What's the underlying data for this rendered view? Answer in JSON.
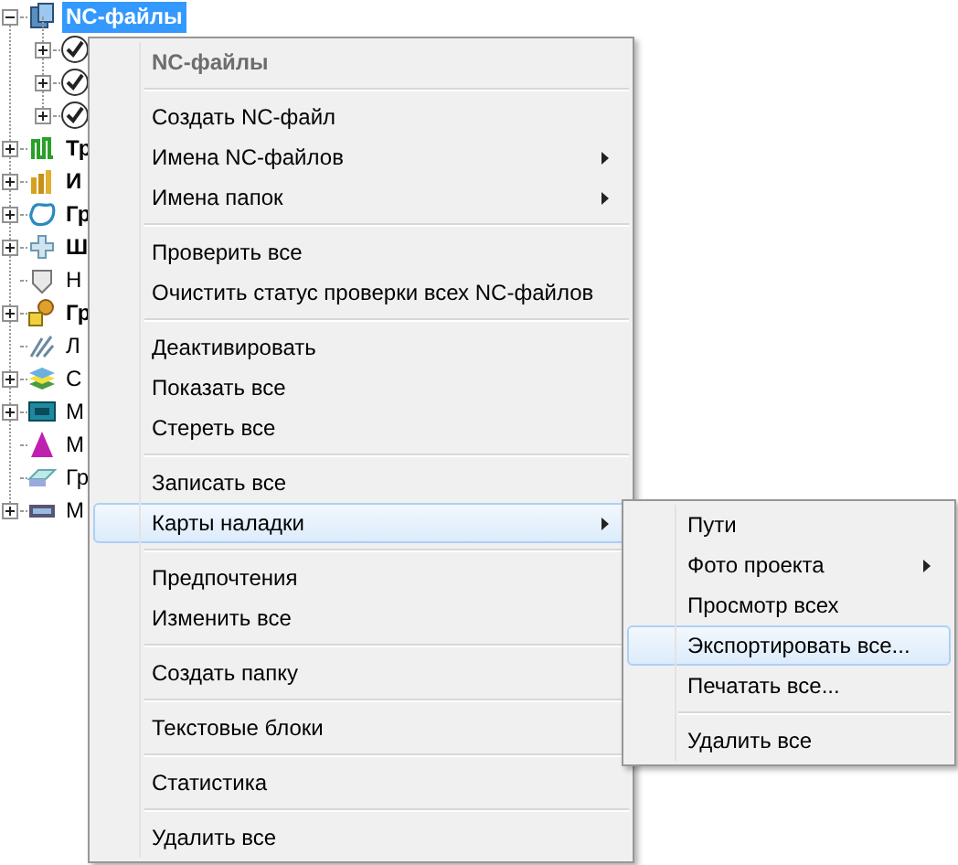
{
  "tree": [
    {
      "label": "NC-файлы",
      "bold": true,
      "selected": true,
      "expandable": true,
      "children": [
        {
          "expandable": true
        },
        {
          "expandable": true
        },
        {
          "expandable": true
        }
      ]
    },
    {
      "label": "Тр",
      "bold": true,
      "selected": false,
      "expandable": true
    },
    {
      "label": "И",
      "bold": true,
      "selected": false,
      "expandable": true
    },
    {
      "label": "Гр",
      "bold": true,
      "selected": false,
      "expandable": true
    },
    {
      "label": "Ш",
      "bold": true,
      "selected": false,
      "expandable": true
    },
    {
      "label": "Н",
      "bold": false,
      "selected": false,
      "expandable": false
    },
    {
      "label": "Гр",
      "bold": true,
      "selected": false,
      "expandable": true
    },
    {
      "label": "Л",
      "bold": false,
      "selected": false,
      "expandable": false
    },
    {
      "label": "С",
      "bold": false,
      "selected": false,
      "expandable": true
    },
    {
      "label": "М",
      "bold": false,
      "selected": false,
      "expandable": true
    },
    {
      "label": "М",
      "bold": false,
      "selected": false,
      "expandable": false
    },
    {
      "label": "Гр",
      "bold": false,
      "selected": false,
      "expandable": false
    },
    {
      "label": "М",
      "bold": false,
      "selected": false,
      "expandable": true
    }
  ],
  "context_menu": [
    {
      "kind": "header",
      "label": "NC-файлы"
    },
    {
      "kind": "separator"
    },
    {
      "kind": "item",
      "label": "Создать NC-файл",
      "submenu": false,
      "selected": false
    },
    {
      "kind": "item",
      "label": "Имена NC-файлов",
      "submenu": true,
      "selected": false
    },
    {
      "kind": "item",
      "label": "Имена папок",
      "submenu": true,
      "selected": false
    },
    {
      "kind": "separator"
    },
    {
      "kind": "item",
      "label": "Проверить все",
      "submenu": false,
      "selected": false
    },
    {
      "kind": "item",
      "label": "Очистить статус проверки всех NC-файлов",
      "submenu": false,
      "selected": false
    },
    {
      "kind": "separator"
    },
    {
      "kind": "item",
      "label": "Деактивировать",
      "submenu": false,
      "selected": false
    },
    {
      "kind": "item",
      "label": "Показать все",
      "submenu": false,
      "selected": false
    },
    {
      "kind": "item",
      "label": "Стереть все",
      "submenu": false,
      "selected": false
    },
    {
      "kind": "separator"
    },
    {
      "kind": "item",
      "label": "Записать все",
      "submenu": false,
      "selected": false
    },
    {
      "kind": "item",
      "label": "Карты наладки",
      "submenu": true,
      "selected": true
    },
    {
      "kind": "separator"
    },
    {
      "kind": "item",
      "label": "Предпочтения",
      "submenu": false,
      "selected": false
    },
    {
      "kind": "item",
      "label": "Изменить все",
      "submenu": false,
      "selected": false
    },
    {
      "kind": "separator"
    },
    {
      "kind": "item",
      "label": "Создать папку",
      "submenu": false,
      "selected": false
    },
    {
      "kind": "separator"
    },
    {
      "kind": "item",
      "label": "Текстовые блоки",
      "submenu": false,
      "selected": false
    },
    {
      "kind": "separator"
    },
    {
      "kind": "item",
      "label": "Статистика",
      "submenu": false,
      "selected": false
    },
    {
      "kind": "separator"
    },
    {
      "kind": "item",
      "label": "Удалить все",
      "submenu": false,
      "selected": false
    }
  ],
  "submenu": [
    {
      "kind": "item",
      "label": "Пути",
      "submenu": false,
      "selected": false
    },
    {
      "kind": "item",
      "label": "Фото проекта",
      "submenu": true,
      "selected": false
    },
    {
      "kind": "item",
      "label": "Просмотр всех",
      "submenu": false,
      "selected": false
    },
    {
      "kind": "item",
      "label": "Экспортировать все...",
      "submenu": false,
      "selected": true
    },
    {
      "kind": "item",
      "label": "Печатать все...",
      "submenu": false,
      "selected": false
    },
    {
      "kind": "separator"
    },
    {
      "kind": "item",
      "label": "Удалить все",
      "submenu": false,
      "selected": false
    }
  ]
}
